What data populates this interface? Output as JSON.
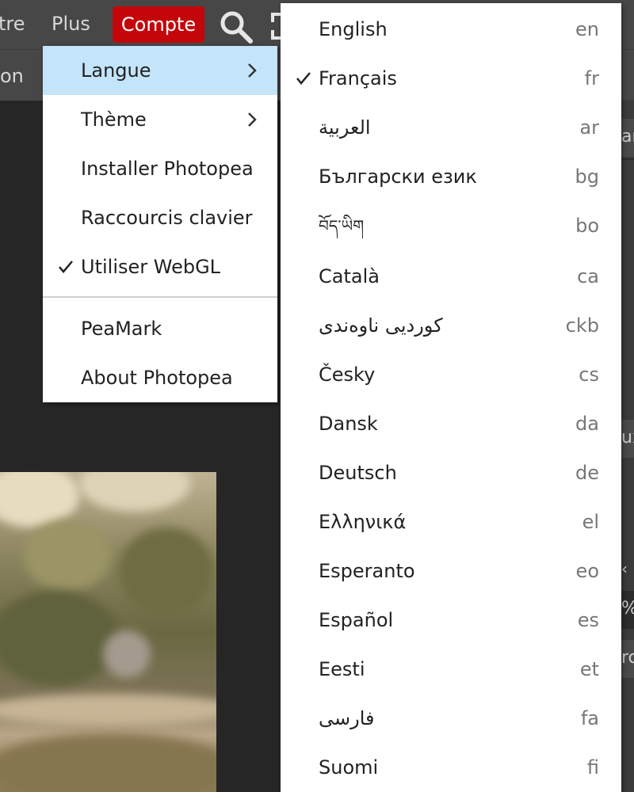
{
  "topbar": {
    "partial_left_label": "tre",
    "plus_label": "Plus",
    "compte_label": "Compte",
    "search_icon": "search-icon",
    "fullscreen_icon": "fullscreen-icon"
  },
  "options_bar": {
    "partial_label": "on"
  },
  "right_panel": {
    "partial_1": "ar",
    "partial_2": "ux",
    "partial_3": "%",
    "partial_4": "rc"
  },
  "account_menu": {
    "items": [
      {
        "label": "Langue",
        "has_submenu": true,
        "active": true
      },
      {
        "label": "Thème",
        "has_submenu": true
      },
      {
        "label": "Installer Photopea"
      },
      {
        "label": "Raccourcis clavier"
      },
      {
        "label": "Utiliser WebGL",
        "checked": true
      },
      {
        "label": "PeaMark"
      },
      {
        "label": "About Photopea"
      }
    ]
  },
  "language_menu": {
    "items": [
      {
        "name": "English",
        "code": "en"
      },
      {
        "name": "Français",
        "code": "fr",
        "checked": true
      },
      {
        "name": "العربية",
        "code": "ar"
      },
      {
        "name": "Български език",
        "code": "bg"
      },
      {
        "name": "བོད་ཡིག",
        "code": "bo"
      },
      {
        "name": "Català",
        "code": "ca"
      },
      {
        "name": "كوردیی ناوەندی",
        "code": "ckb"
      },
      {
        "name": "Česky",
        "code": "cs"
      },
      {
        "name": "Dansk",
        "code": "da"
      },
      {
        "name": "Deutsch",
        "code": "de"
      },
      {
        "name": "Ελληνικά",
        "code": "el"
      },
      {
        "name": "Esperanto",
        "code": "eo"
      },
      {
        "name": "Español",
        "code": "es"
      },
      {
        "name": "Eesti",
        "code": "et"
      },
      {
        "name": "فارسی",
        "code": "fa"
      },
      {
        "name": "Suomi",
        "code": "fi"
      }
    ]
  },
  "colors": {
    "accent_red": "#c4060a",
    "menu_highlight": "#c4e4fa",
    "toolbar_bg": "#474747",
    "workspace_bg": "#262626"
  }
}
